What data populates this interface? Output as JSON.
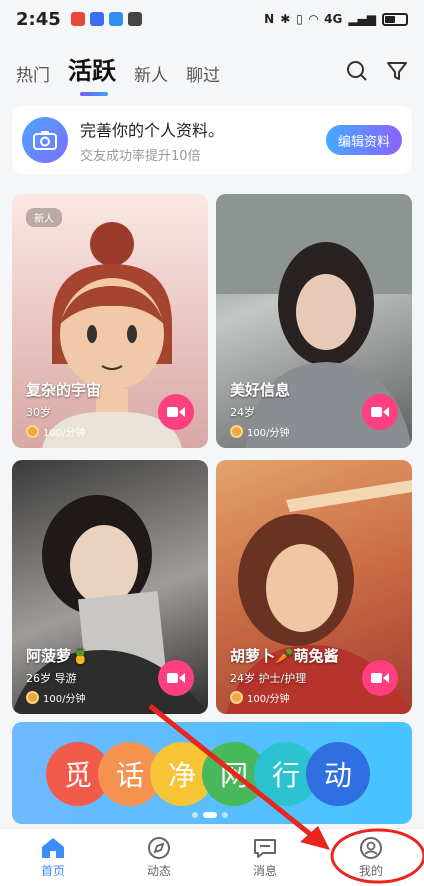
{
  "status_bar": {
    "time": "2:45",
    "network": "4G"
  },
  "tabs": [
    {
      "label": "热门"
    },
    {
      "label": "活跃"
    },
    {
      "label": "新人"
    },
    {
      "label": "聊过"
    }
  ],
  "profile_banner": {
    "title": "完善你的个人资料。",
    "subtitle": "交友成功率提升10倍",
    "button": "编辑资料"
  },
  "cards": [
    {
      "tag": "新人",
      "name": "复杂的宇宙",
      "age": "30岁",
      "price": "100/分钟"
    },
    {
      "name": "美好信息",
      "age": "24岁",
      "price": "100/分钟"
    },
    {
      "name": "阿菠萝🍍",
      "age": "26岁  导游",
      "price": "100/分钟"
    },
    {
      "name": "胡萝卜🥕萌兔酱",
      "age": "24岁  护士/护理",
      "price": "100/分钟"
    }
  ],
  "campaign": {
    "chars": [
      "觅",
      "话",
      "净",
      "网",
      "行",
      "动"
    ],
    "colors": [
      "#f25b4b",
      "#f5924f",
      "#f7c436",
      "#49b85a",
      "#2cc3d0",
      "#2f6fe0"
    ]
  },
  "nav": [
    {
      "label": "首页",
      "icon": "home-icon"
    },
    {
      "label": "动态",
      "icon": "compass-icon"
    },
    {
      "label": "消息",
      "icon": "chat-icon"
    },
    {
      "label": "我的",
      "icon": "profile-icon"
    }
  ],
  "colors": {
    "accent": "#3a8cff",
    "video": "#ff3f7f",
    "annotation": "#e8261f"
  }
}
